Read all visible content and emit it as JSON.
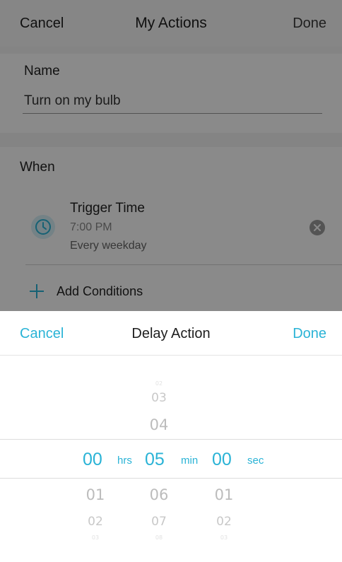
{
  "nav": {
    "cancel_label": "Cancel",
    "title": "My Actions",
    "done_label": "Done"
  },
  "name_section": {
    "label": "Name",
    "value": "Turn on my bulb"
  },
  "when_section": {
    "label": "When",
    "trigger": {
      "title": "Trigger Time",
      "time": "7:00 PM",
      "repeat": "Every weekday",
      "icon": "clock-icon"
    },
    "add_conditions_label": "Add Conditions"
  },
  "delay_sheet": {
    "cancel_label": "Cancel",
    "title": "Delay Action",
    "done_label": "Done",
    "accent_color": "#2ab3d6",
    "hours": {
      "selected": "00",
      "unit": "hrs",
      "below": [
        "01",
        "02"
      ]
    },
    "minutes": {
      "selected": "05",
      "unit": "min",
      "above": [
        "03",
        "04"
      ],
      "below": [
        "06",
        "07"
      ]
    },
    "seconds": {
      "selected": "00",
      "unit": "sec",
      "below": [
        "01",
        "02"
      ]
    }
  }
}
